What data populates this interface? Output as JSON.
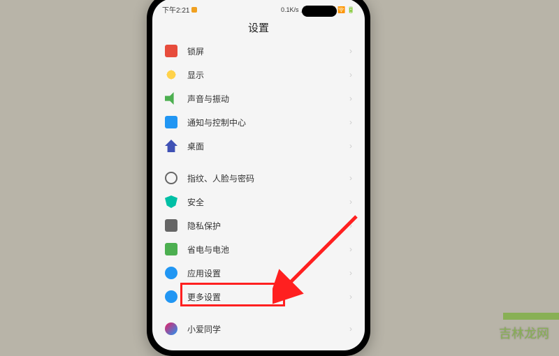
{
  "status_bar": {
    "time": "下午2:21",
    "network": "0.1K/s",
    "indicators": "⏅ ⚡ 📶 📶 🛜 🔋"
  },
  "header": {
    "title": "设置"
  },
  "settings": {
    "items": [
      {
        "icon": "ic-red",
        "label": "锁屏",
        "icon_name": "lock-screen-icon"
      },
      {
        "icon": "ic-sun",
        "label": "显示",
        "icon_name": "display-icon"
      },
      {
        "icon": "ic-speaker",
        "label": "声音与振动",
        "icon_name": "sound-icon"
      },
      {
        "icon": "ic-notif",
        "label": "通知与控制中心",
        "icon_name": "notification-icon"
      },
      {
        "icon": "ic-home",
        "label": "桌面",
        "icon_name": "home-icon"
      },
      {
        "icon": "ic-finger",
        "label": "指纹、人脸与密码",
        "icon_name": "fingerprint-icon",
        "spacer": true
      },
      {
        "icon": "ic-shield",
        "label": "安全",
        "icon_name": "security-icon"
      },
      {
        "icon": "ic-privacy",
        "label": "隐私保护",
        "icon_name": "privacy-icon"
      },
      {
        "icon": "ic-battery",
        "label": "省电与电池",
        "icon_name": "battery-icon"
      },
      {
        "icon": "ic-gear",
        "label": "应用设置",
        "icon_name": "app-settings-icon"
      },
      {
        "icon": "ic-more",
        "label": "更多设置",
        "icon_name": "more-settings-icon"
      },
      {
        "icon": "ic-ai",
        "label": "小爱同学",
        "icon_name": "xiaoai-icon",
        "spacer": true
      }
    ]
  },
  "annotation": {
    "highlighted_item": "更多设置"
  },
  "watermark": "吉林龙网"
}
